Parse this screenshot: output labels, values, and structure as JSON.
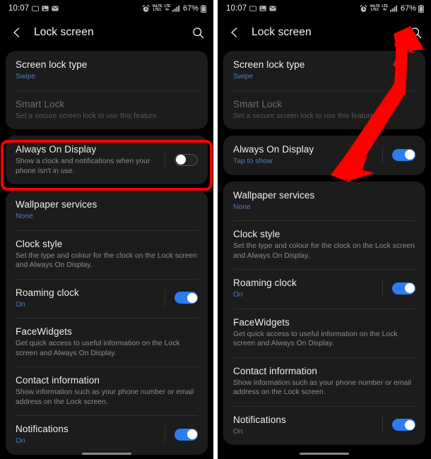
{
  "status_bar": {
    "time": "10:07",
    "battery_percent": "67%",
    "icons_left": [
      "tablet-icon",
      "image-icon",
      "message-icon"
    ],
    "icons_right": [
      "alarm-icon",
      "volte-icon",
      "lte-icon",
      "signal-bars-icon",
      "battery-icon"
    ],
    "volte_label_top": "VoLTE",
    "volte_label_bottom": "LTE1",
    "lte_label_top": "LTE",
    "lte_label_bottom": "4+"
  },
  "app_bar": {
    "title": "Lock screen",
    "back_icon": "back-chevron-icon",
    "search_icon": "search-icon"
  },
  "panels": [
    {
      "id": "before",
      "highlight": true,
      "arrow": false,
      "cards": [
        {
          "rows": [
            {
              "title": "Screen lock type",
              "subtitle": "Swipe",
              "subtitle_accent": true,
              "toggle": null,
              "disabled": false
            },
            {
              "title": "Smart Lock",
              "subtitle": "Set a secure screen lock to use this feature.",
              "subtitle_accent": false,
              "toggle": null,
              "disabled": true
            }
          ]
        },
        {
          "rows": [
            {
              "title": "Always On Display",
              "subtitle": "Show a clock and notifications when your phone isn't in use.",
              "subtitle_accent": false,
              "toggle": "off",
              "disabled": false
            }
          ]
        },
        {
          "rows": [
            {
              "title": "Wallpaper services",
              "subtitle": "None",
              "subtitle_accent": true,
              "toggle": null,
              "disabled": false
            },
            {
              "title": "Clock style",
              "subtitle": "Set the type and colour for the clock on the Lock screen and Always On Display.",
              "subtitle_accent": false,
              "toggle": null,
              "disabled": false
            },
            {
              "title": "Roaming clock",
              "subtitle": "On",
              "subtitle_accent": true,
              "toggle": "on",
              "disabled": false
            },
            {
              "title": "FaceWidgets",
              "subtitle": "Get quick access to useful information on the Lock screen and Always On Display.",
              "subtitle_accent": false,
              "toggle": null,
              "disabled": false
            },
            {
              "title": "Contact information",
              "subtitle": "Show information such as your phone number or email address on the Lock screen.",
              "subtitle_accent": false,
              "toggle": null,
              "disabled": false
            },
            {
              "title": "Notifications",
              "subtitle": "On",
              "subtitle_accent": true,
              "toggle": "on",
              "disabled": false
            }
          ]
        }
      ]
    },
    {
      "id": "after",
      "highlight": false,
      "arrow": true,
      "cards": [
        {
          "rows": [
            {
              "title": "Screen lock type",
              "subtitle": "Swipe",
              "subtitle_accent": true,
              "toggle": null,
              "disabled": false
            },
            {
              "title": "Smart Lock",
              "subtitle": "Set a secure screen lock to use this feature.",
              "subtitle_accent": false,
              "toggle": null,
              "disabled": true
            }
          ]
        },
        {
          "rows": [
            {
              "title": "Always On Display",
              "subtitle": "Tap to show",
              "subtitle_accent": true,
              "toggle": "on",
              "disabled": false
            }
          ]
        },
        {
          "rows": [
            {
              "title": "Wallpaper services",
              "subtitle": "None",
              "subtitle_accent": true,
              "toggle": null,
              "disabled": false
            },
            {
              "title": "Clock style",
              "subtitle": "Set the type and colour for the clock on the Lock screen and Always On Display.",
              "subtitle_accent": false,
              "toggle": null,
              "disabled": false
            },
            {
              "title": "Roaming clock",
              "subtitle": "On",
              "subtitle_accent": true,
              "toggle": "on",
              "disabled": false
            },
            {
              "title": "FaceWidgets",
              "subtitle": "Get quick access to useful information on the Lock screen and Always On Display.",
              "subtitle_accent": false,
              "toggle": null,
              "disabled": false
            },
            {
              "title": "Contact information",
              "subtitle": "Show information such as your phone number or email address on the Lock screen.",
              "subtitle_accent": false,
              "toggle": null,
              "disabled": false
            },
            {
              "title": "Notifications",
              "subtitle": "On",
              "subtitle_accent": true,
              "toggle": "on",
              "disabled": false
            }
          ]
        }
      ]
    }
  ],
  "annotations": {
    "highlight_color": "#fe0000",
    "arrow_color": "#fe0000",
    "arrow_target": "always-on-display-toggle"
  },
  "colors": {
    "screen_background": "#000000",
    "card_background": "#1c1c1c",
    "accent_blue": "#4a7ec4",
    "toggle_on": "#2e7df0",
    "title_text": "#f0f0f0",
    "subtitle_text": "#8f8f8f"
  }
}
